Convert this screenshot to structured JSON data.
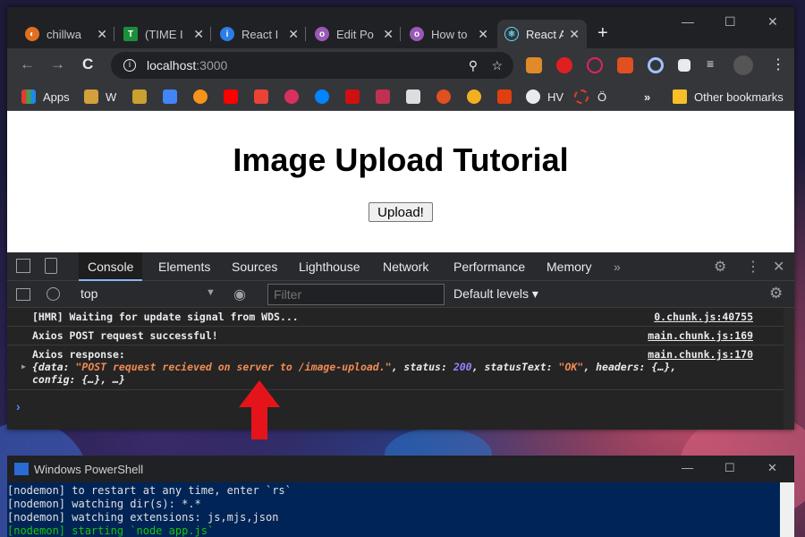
{
  "chrome": {
    "tabs": [
      {
        "label": "chillwa",
        "close": "✕",
        "fav_color": "#e07020"
      },
      {
        "label": "(TIME I",
        "close": "✕",
        "fav_color": "#1b8f3a"
      },
      {
        "label": "React I",
        "close": "✕",
        "fav_color": "#2b7de9"
      },
      {
        "label": "Edit Po",
        "close": "✕",
        "fav_color": "#9b59b6"
      },
      {
        "label": "How to",
        "close": "✕",
        "fav_color": "#9b59b6"
      },
      {
        "label": "React A",
        "close": "✕",
        "fav_color": "#61dafb"
      }
    ],
    "new_tab": "+",
    "window_controls": {
      "minimize": "—",
      "maximize": "☐",
      "close": "✕"
    },
    "nav": {
      "back": "←",
      "forward": "→",
      "reload": "C"
    },
    "address": {
      "host": "localhost",
      "port": ":3000"
    },
    "bookmarks": {
      "apps": "Apps",
      "w": "W",
      "hv": "HV",
      "o": "Ö",
      "more": "»",
      "other": "Other bookmarks"
    }
  },
  "page": {
    "heading": "Image Upload Tutorial",
    "button": "Upload!"
  },
  "devtools": {
    "tabs": [
      "Console",
      "Elements",
      "Sources",
      "Lighthouse",
      "Network",
      "Performance",
      "Memory",
      "»"
    ],
    "context": "top",
    "filter_placeholder": "Filter",
    "levels": "Default levels ▾",
    "logs": [
      {
        "text": "[HMR] Waiting for update signal from WDS...",
        "source": "0.chunk.js:40755"
      },
      {
        "text": "Axios POST request successful!",
        "source": "main.chunk.js:169"
      },
      {
        "text": "Axios response:",
        "source": "main.chunk.js:170"
      }
    ],
    "response": {
      "open": "{data: ",
      "data": "\"POST request recieved on server to /image-upload.\"",
      "status_key": ", status: ",
      "status": "200",
      "statusText_key": ", statusText: ",
      "statusText": "\"OK\"",
      "tail1": ", headers: {…},",
      "tail2": "config: {…}, …}"
    },
    "prompt": "›"
  },
  "powershell": {
    "title": "Windows PowerShell",
    "lines": [
      "[nodemon] to restart at any time, enter `rs`",
      "[nodemon] watching dir(s): *.*",
      "[nodemon] watching extensions: js,mjs,json",
      "[nodemon] starting `node app.js`"
    ]
  },
  "colors": {
    "arrow": "#e4141a",
    "accent": "#8ab4f8"
  }
}
